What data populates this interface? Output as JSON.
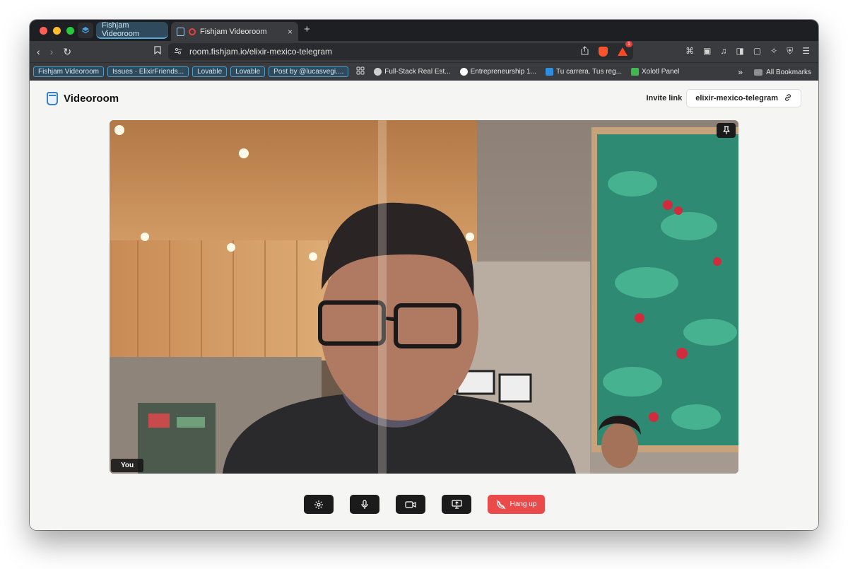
{
  "browser": {
    "tab_group_label": "Fishjam Videoroom",
    "active_tab_title": "Fishjam Videoroom",
    "tab_close_glyph": "×",
    "new_tab_glyph": "+",
    "url": "room.fishjam.io/elixir-mexico-telegram",
    "rewards_badge": "1",
    "bookmarks": [
      {
        "label": "Fishjam Videoroom",
        "style": "chip"
      },
      {
        "label": "Issues · ElixirFriends...",
        "style": "chip"
      },
      {
        "label": "Lovable",
        "style": "chip"
      },
      {
        "label": "Lovable",
        "style": "chip"
      },
      {
        "label": "Post by @lucasvegi....",
        "style": "chip"
      },
      {
        "label": "Full-Stack Real Est...",
        "style": "link",
        "icon_color": "#cfcfcf"
      },
      {
        "label": "Entrepreneurship 1...",
        "style": "link",
        "icon_color": "#ffffff"
      },
      {
        "label": "Tu carrera. Tus reg...",
        "style": "link",
        "icon_color": "#2f8fe0"
      },
      {
        "label": "Xolotl Panel",
        "style": "link",
        "icon_color": "#3fb950"
      }
    ],
    "more_bookmarks_glyph": "»",
    "all_bookmarks_label": "All Bookmarks"
  },
  "app": {
    "title": "Videoroom",
    "invite_label": "Invite link",
    "room_name": "elixir-mexico-telegram",
    "video_tile_label": "You",
    "hangup_label": "Hang up",
    "colors": {
      "hangup": "#ea4a4a",
      "control": "#1b1b1b",
      "accent": "#3b7fc4"
    }
  }
}
